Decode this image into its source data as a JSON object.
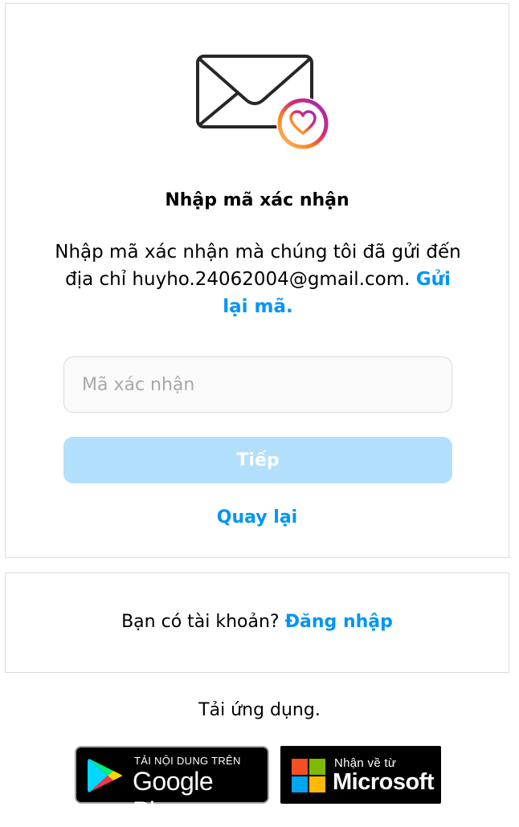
{
  "verify_card": {
    "envelope_icon": "envelope-with-heart-icon",
    "title": "Nhập mã xác nhận",
    "description_text": "Nhập mã xác nhận mà chúng tôi đã gửi đến địa chỉ huyho.24062004@gmail.com. ",
    "resend_label": "Gửi lại mã.",
    "code_input": {
      "placeholder": "Mã xác nhận",
      "value": ""
    },
    "next_label": "Tiếp",
    "back_label": "Quay lại"
  },
  "login_card": {
    "prompt": "Bạn có tài khoản? ",
    "login_label": "Đăng nhập"
  },
  "get_app": {
    "label": "Tải ứng dụng.",
    "google_play": {
      "small_text": "TẢI NỘI DUNG TRÊN",
      "big_text": "Google Play"
    },
    "microsoft": {
      "small_text": "Nhận về từ",
      "big_text": "Microsoft"
    }
  },
  "colors": {
    "accent": "#0095f6",
    "button_disabled": "#b2dffc",
    "border": "#dbdbdb",
    "input_bg": "#fafafa"
  }
}
